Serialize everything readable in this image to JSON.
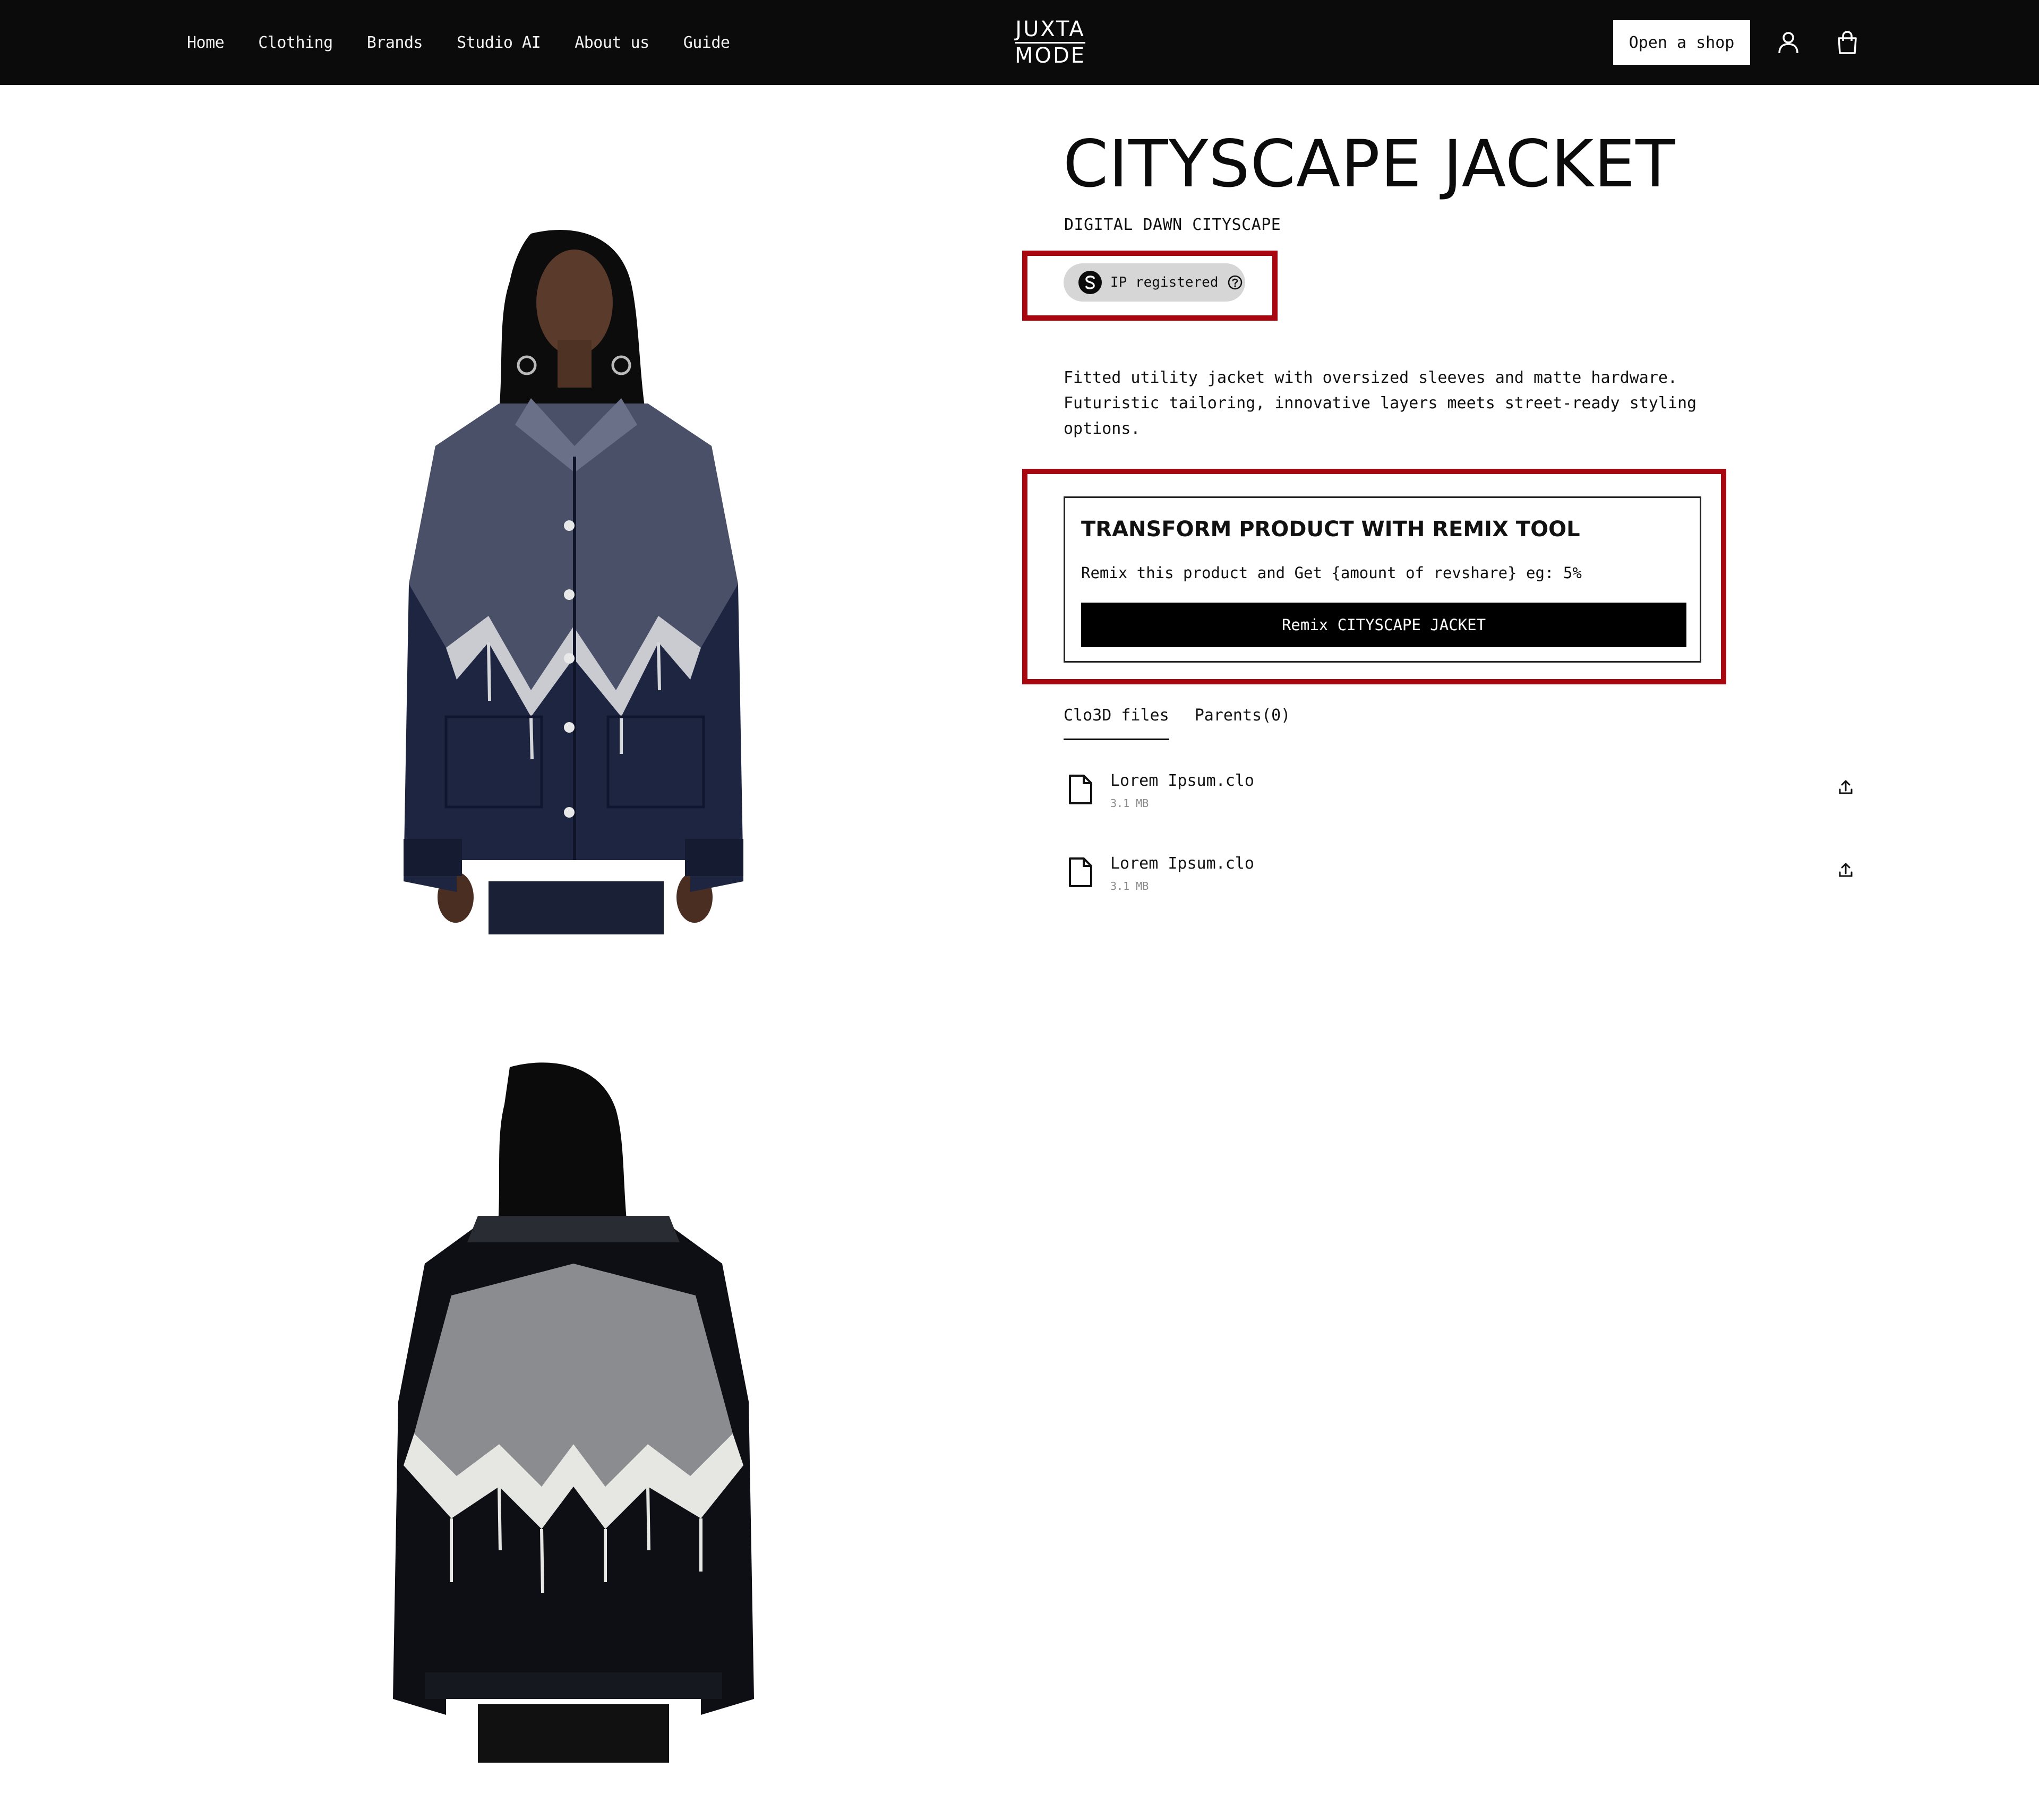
{
  "nav": {
    "links": [
      "Home",
      "Clothing",
      "Brands",
      "Studio AI",
      "About us",
      "Guide"
    ],
    "logo_top": "JUXTA",
    "logo_bottom": "MODE",
    "open_shop_label": "Open a shop",
    "user_icon": "user-icon",
    "bag_icon": "shopping-bag-icon"
  },
  "product": {
    "title": "CITYSCAPE JACKET",
    "collection": "DIGITAL DAWN CITYSCAPE",
    "ip_badge_label": "IP registered",
    "description": "Fitted utility jacket with oversized sleeves and matte hardware. Futuristic tailoring, innovative layers meets street-ready styling options."
  },
  "remix": {
    "title": "TRANSFORM PRODUCT WITH REMIX TOOL",
    "text": "Remix this product and Get {amount of revshare} eg: 5%",
    "button_label": "Remix CITYSCAPE JACKET"
  },
  "tabs": [
    "Clo3D files",
    "Parents(0)"
  ],
  "files": [
    {
      "name": "Lorem Ipsum.clo",
      "size": "3.1 MB"
    },
    {
      "name": "Lorem Ipsum.clo",
      "size": "3.1 MB"
    }
  ],
  "colors": {
    "topbar": "#0b0b0b",
    "highlight": "#a8070f",
    "badge_bg": "#d6d6d6",
    "denim": "#1d2540",
    "vinyl": "#0d0f15"
  }
}
